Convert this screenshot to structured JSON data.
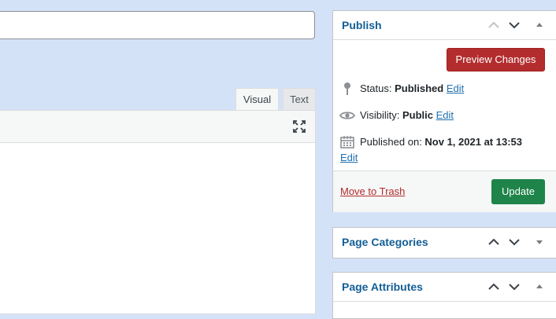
{
  "editor": {
    "tabs": [
      {
        "label": "Visual"
      },
      {
        "label": "Text"
      }
    ]
  },
  "publish": {
    "title": "Publish",
    "preview_label": "Preview Changes",
    "status_label": "Status:",
    "status_value": "Published",
    "visibility_label": "Visibility:",
    "visibility_value": "Public",
    "published_label": "Published on:",
    "published_value": "Nov 1, 2021 at 13:53",
    "edit_label": "Edit",
    "trash_label": "Move to Trash",
    "update_label": "Update"
  },
  "categories": {
    "title": "Page Categories"
  },
  "attributes": {
    "title": "Page Attributes"
  },
  "colors": {
    "accent": "#2271b1",
    "danger": "#b32d2e",
    "update": "#1e8449",
    "background": "#d4e2f8"
  }
}
